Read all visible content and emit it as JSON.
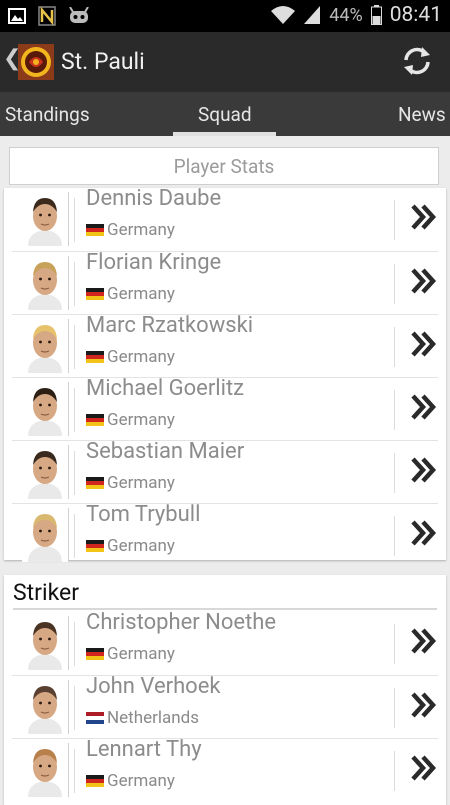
{
  "status_bar": {
    "battery": "44%",
    "time": "08:41",
    "icons": [
      "image-icon",
      "n-icon",
      "android-icon",
      "wifi-icon",
      "signal-icon"
    ]
  },
  "action_bar": {
    "title": "St. Pauli",
    "icons": [
      "back-chevron-icon",
      "club-logo-icon",
      "refresh-icon"
    ]
  },
  "tabs": {
    "items": [
      "Standings",
      "Squad",
      "News"
    ],
    "selected": "Squad"
  },
  "player_stats_button": "Player Stats",
  "sections": [
    {
      "heading": "",
      "players": [
        {
          "name": "Dennis Daube",
          "country": "Germany"
        },
        {
          "name": "Florian Kringe",
          "country": "Germany"
        },
        {
          "name": "Marc Rzatkowski",
          "country": "Germany"
        },
        {
          "name": "Michael Goerlitz",
          "country": "Germany"
        },
        {
          "name": "Sebastian Maier",
          "country": "Germany"
        },
        {
          "name": "Tom Trybull",
          "country": "Germany"
        }
      ]
    },
    {
      "heading": "Striker",
      "players": [
        {
          "name": "Christopher Noethe",
          "country": "Germany"
        },
        {
          "name": "John Verhoek",
          "country": "Netherlands"
        },
        {
          "name": "Lennart Thy",
          "country": "Germany"
        }
      ]
    }
  ],
  "colors": {
    "action_bar": "#2a2a2a",
    "tab_bar": "#3a3a3a",
    "status_bar": "#000000"
  }
}
